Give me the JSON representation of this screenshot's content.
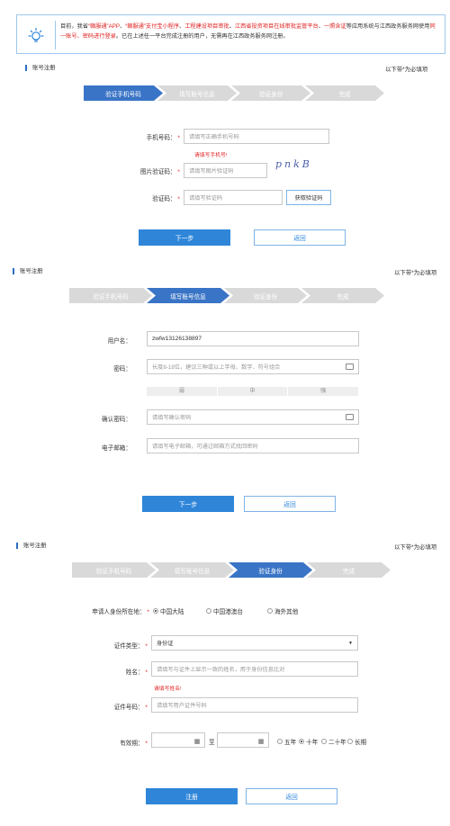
{
  "notice": {
    "icon": "lightbulb-icon",
    "segments": [
      {
        "text": "目前，我省",
        "red": false
      },
      {
        "text": "“赣服通”APP",
        "red": true
      },
      {
        "text": "、",
        "red": false
      },
      {
        "text": "“赣服通”支付宝小程序",
        "red": true
      },
      {
        "text": "、",
        "red": false
      },
      {
        "text": "工程建设项目审批",
        "red": true
      },
      {
        "text": "、",
        "red": false
      },
      {
        "text": "江西省投资项目在线审批监管平台",
        "red": true
      },
      {
        "text": "、",
        "red": false
      },
      {
        "text": "一照含证",
        "red": true
      },
      {
        "text": "等应用系统与江西政务服务网使用",
        "red": false
      },
      {
        "text": "同一账号、密码进行登录",
        "red": true
      },
      {
        "text": "。已在上述任一平台完成注册的用户，无需再在江西政务服务网注册。",
        "red": false
      }
    ]
  },
  "common": {
    "section_title": "账号注册",
    "required_note": "以下带*为必填项",
    "steps": [
      "验证手机号码",
      "填写账号信息",
      "验证身份",
      "完成"
    ],
    "star": "*",
    "back": "返回"
  },
  "panel1": {
    "active_step": 0,
    "phone_label": "手机号码：",
    "phone_placeholder": "请填写正确手机号码",
    "phone_error": "请填写手机号!",
    "captcha_label": "图片验证码：",
    "captcha_placeholder": "请填写图片验证码",
    "captcha_text": "pnkB",
    "code_label": "验证码：",
    "code_placeholder": "请填写验证码",
    "get_code": "获取验证码",
    "next": "下一步"
  },
  "panel2": {
    "active_step": 1,
    "username_label": "用户名：",
    "username_value": "zwfw13126138897",
    "password_label": "密码：",
    "password_placeholder": "长度8-18位，建议三种或以上字母、数字、符号组合",
    "strength": [
      "弱",
      "中",
      "强"
    ],
    "confirm_label": "确认密码：",
    "confirm_placeholder": "请填写确认密码",
    "email_label": "电子邮箱：",
    "email_placeholder": "请填写电子邮箱，可通过邮箱方式找回密码",
    "next": "下一步"
  },
  "panel3": {
    "active_step": 2,
    "region_label": "申请人身份所在地：",
    "regions": [
      "中国大陆",
      "中国港澳台",
      "海外其他"
    ],
    "region_selected": 0,
    "idtype_label": "证件类型：",
    "idtype_value": "身份证",
    "name_label": "姓名：",
    "name_placeholder": "请填写与证件上显示一致的姓名，用于身份信息比对",
    "name_error": "请填写姓名!",
    "idno_label": "证件号码：",
    "idno_placeholder": "请填写用户证件号码",
    "validity_label": "有效期：",
    "to": "至",
    "periods": [
      "五年",
      "十年",
      "二十年",
      "长期"
    ],
    "period_selected": 1,
    "submit": "注册"
  }
}
